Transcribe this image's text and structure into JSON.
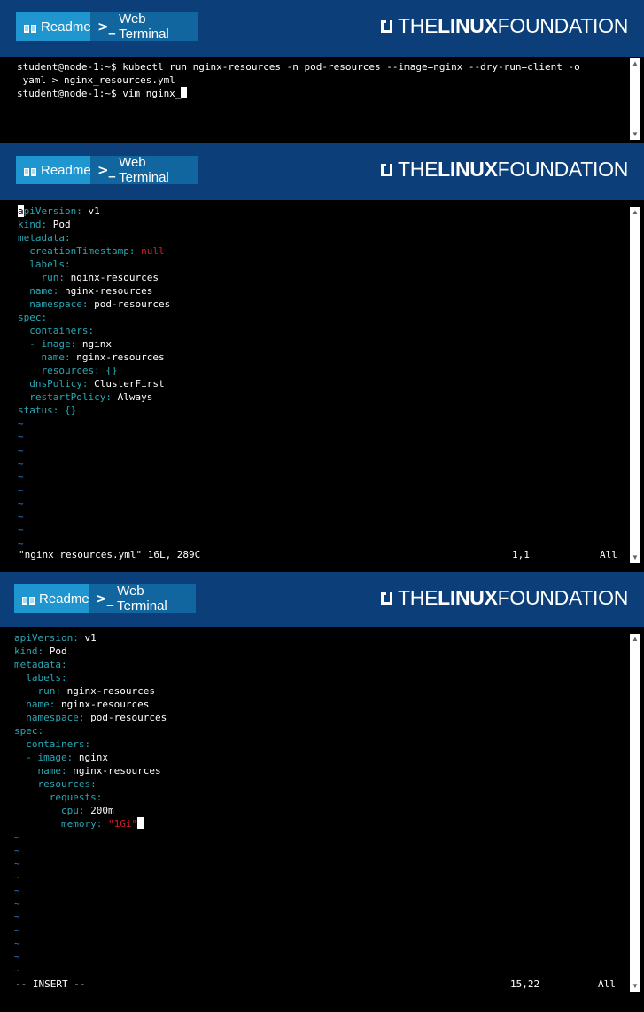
{
  "header": {
    "readme_label": "Readme",
    "terminal_label": "Web Terminal",
    "logo_prefix": "THE",
    "logo_bold": "LINUX",
    "logo_suffix": "FOUNDATION"
  },
  "panel1": {
    "line1": "student@node-1:~$ kubectl run nginx-resources -n pod-resources --image=nginx --dry-run=client -o",
    "line2": " yaml > nginx_resources.yml",
    "line3": "student@node-1:~$ vim nginx_"
  },
  "panel2": {
    "lines": [
      {
        "k": "apiVersion:",
        "v": " v1"
      },
      {
        "k": "kind:",
        "v": " Pod"
      },
      {
        "k": "metadata:",
        "v": ""
      },
      {
        "k": "  creationTimestamp:",
        "v": "",
        "red": " null"
      },
      {
        "k": "  labels:",
        "v": ""
      },
      {
        "k": "    run:",
        "v": " nginx-resources"
      },
      {
        "k": "  name:",
        "v": " nginx-resources"
      },
      {
        "k": "  namespace:",
        "v": " pod-resources"
      },
      {
        "k": "spec:",
        "v": ""
      },
      {
        "k": "  containers:",
        "v": ""
      },
      {
        "k": "  - image:",
        "v": " nginx"
      },
      {
        "k": "    name:",
        "v": " nginx-resources"
      },
      {
        "k": "    resources: {}",
        "v": ""
      },
      {
        "k": "  dnsPolicy:",
        "v": " ClusterFirst"
      },
      {
        "k": "  restartPolicy:",
        "v": " Always"
      },
      {
        "k": "status: {}",
        "v": ""
      }
    ],
    "tildes": 10,
    "status_file": "\"nginx_resources.yml\" 16L, 289C",
    "status_pos": "1,1",
    "status_all": "All"
  },
  "panel3": {
    "lines": [
      {
        "k": "apiVersion:",
        "v": " v1"
      },
      {
        "k": "kind:",
        "v": " Pod"
      },
      {
        "k": "metadata:",
        "v": ""
      },
      {
        "k": "  labels:",
        "v": ""
      },
      {
        "k": "    run:",
        "v": " nginx-resources"
      },
      {
        "k": "  name:",
        "v": " nginx-resources"
      },
      {
        "k": "  namespace:",
        "v": " pod-resources"
      },
      {
        "k": "spec:",
        "v": ""
      },
      {
        "k": "  containers:",
        "v": ""
      },
      {
        "k": "  - image:",
        "v": " nginx"
      },
      {
        "k": "    name:",
        "v": " nginx-resources"
      },
      {
        "k": "    resources:",
        "v": ""
      },
      {
        "k": "      requests:",
        "v": ""
      },
      {
        "k": "        cpu:",
        "v": " 200m"
      },
      {
        "k": "        memory:",
        "v": "",
        "red": " \"1Gi\"",
        "cursor": true
      }
    ],
    "tildes": 11,
    "status_mode": "-- INSERT --",
    "status_pos": "15,22",
    "status_all": "All"
  },
  "colors": {
    "header_bg": "#0c3f79",
    "readme_bg": "#1f96d0",
    "terminal_bg": "#12669f",
    "yaml_key": "#2aa6b4",
    "yaml_null": "#d0202a",
    "tilde": "#2a7ad0"
  }
}
